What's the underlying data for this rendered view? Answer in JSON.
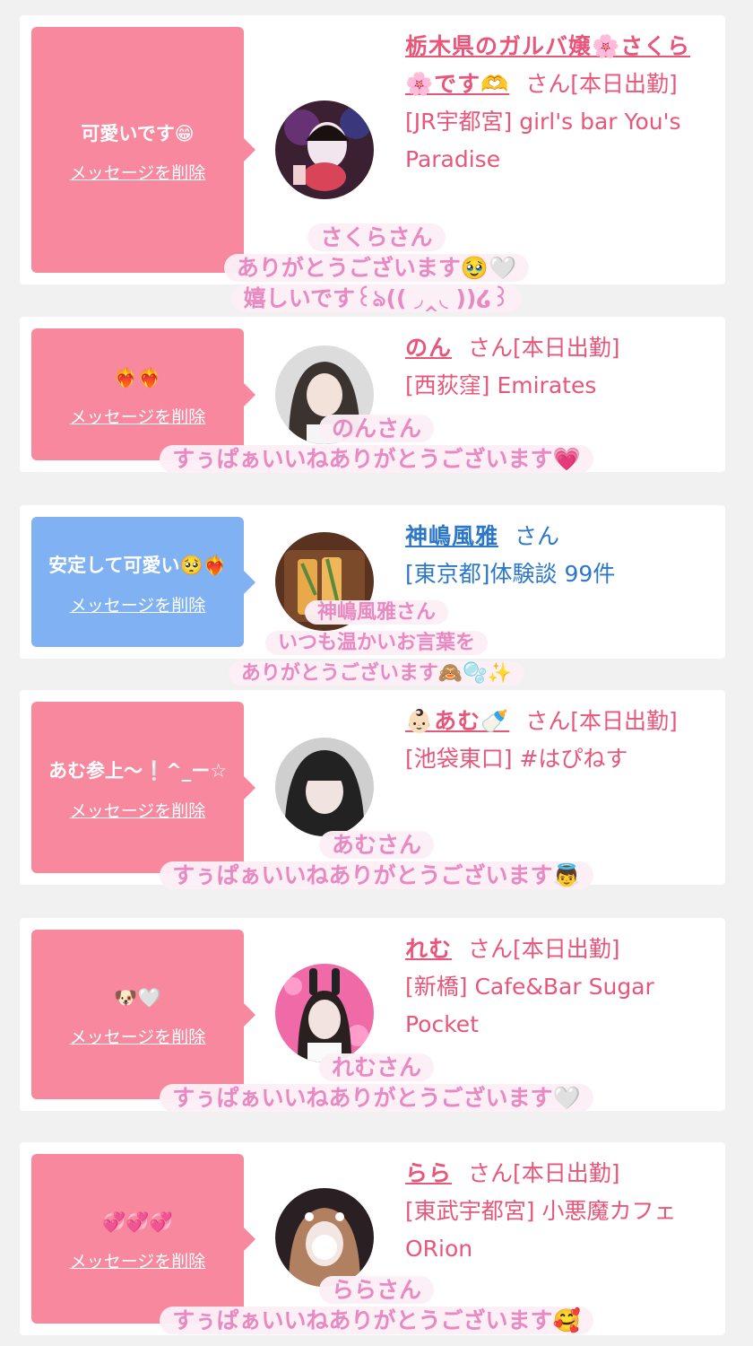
{
  "cards": [
    {
      "message": "可愛いです😁",
      "delete_label": "メッセージを削除",
      "name": "栃木県のガルバ嬢🌸さくら🌸です🫶",
      "suffix": "さん[本日出勤]",
      "shop": "[JR宇都宮] girl's bar You's Paradise",
      "overlay": [
        "さくらさん",
        "ありがとうございます🥹🤍",
        "嬉しいです꒰ঌ(( ◞‸◟ ))໒꒱"
      ],
      "bubble_color": "#f7889e"
    },
    {
      "message": "❤️‍🔥❤️‍🔥",
      "delete_label": "メッセージを削除",
      "name": "のん",
      "suffix": "さん[本日出勤]",
      "shop": "[西荻窪] Emirates",
      "overlay": [
        "のんさん",
        "すぅぱぁいいねありがとうございます💗"
      ],
      "bubble_color": "#f7889e"
    },
    {
      "message": "安定して可愛い🥺❤️‍🔥",
      "delete_label": "メッセージを削除",
      "name": "神嶋風雅",
      "suffix": "さん",
      "shop": "[東京都]体験談 99件",
      "overlay": [
        "神嶋風雅さん",
        "いつも温かいお言葉を",
        "ありがとうございます🙈🫧✨"
      ],
      "bubble_color": "#7fb1f3"
    },
    {
      "message": "あむ参上〜❕^_ー☆",
      "delete_label": "メッセージを削除",
      "name": "👶🏻あむ🍼",
      "suffix": "さん[本日出勤]",
      "shop": "[池袋東口] #はぴねす",
      "overlay": [
        "あむさん",
        "すぅぱぁいいねありがとうございます👼"
      ],
      "bubble_color": "#f7889e"
    },
    {
      "message": "🐶🤍",
      "delete_label": "メッセージを削除",
      "name": "れむ",
      "suffix": "さん[本日出勤]",
      "shop": "[新橋] Cafe&Bar Sugar Pocket",
      "overlay": [
        "れむさん",
        "すぅぱぁいいねありがとうございます🤍"
      ],
      "bubble_color": "#f7889e"
    },
    {
      "message": "💞💞💞",
      "delete_label": "メッセージを削除",
      "name": "らら",
      "suffix": "さん[本日出勤]",
      "shop": "[東武宇都宮] 小悪魔カフェORion",
      "overlay": [
        "ららさん",
        "すぅぱぁいいねありがとうございます🥰"
      ],
      "bubble_color": "#f7889e"
    }
  ]
}
